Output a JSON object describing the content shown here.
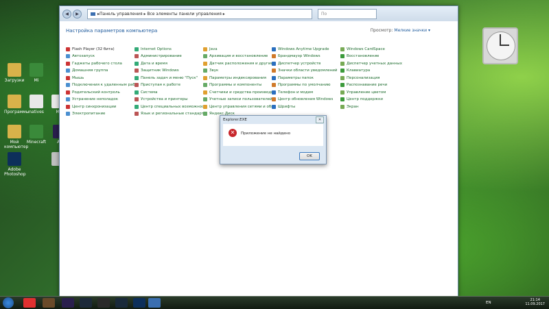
{
  "desktop": {
    "icons": [
      {
        "label": "Загрузки",
        "color": "#d8b24a"
      },
      {
        "label": "Mi",
        "color": "#3a8a3a"
      },
      {
        "label": "Программы",
        "color": "#d8b24a"
      },
      {
        "label": "natives",
        "color": "#e8e8e8"
      },
      {
        "label": "Mi",
        "color": "#e8e8e8"
      },
      {
        "label": "Мой компьютер",
        "color": "#d8b24a"
      },
      {
        "label": "Minecraft",
        "color": "#3a8a3a"
      },
      {
        "label": "Ae",
        "color": "#2a1f4d"
      },
      {
        "label": "Adobe Photoshop",
        "color": "#0d2f5a"
      },
      {
        "label": "",
        "color": "#c0c0c0"
      }
    ]
  },
  "window": {
    "address": {
      "path1": "Панель управления",
      "path2": "Все элементы панели управления",
      "search_placeholder": "По"
    },
    "title": "Настройка параметров компьютера",
    "view_label": "Просмотр:",
    "view_value": "Мелкие значки ▾",
    "items": [
      [
        "Flash Player (32 бита)",
        "Internet Options",
        "Java",
        "Windows Anytime Upgrade",
        "Windows CardSpace"
      ],
      [
        "Автозапуск",
        "Администрирование",
        "Архивация и восстановление",
        "Брандмауэр Windows",
        "Восстановление"
      ],
      [
        "Гаджеты рабочего стола",
        "Дата и время",
        "Датчик расположения и другие дат...",
        "Диспетчер устройств",
        "Диспетчер учетных данных"
      ],
      [
        "Домашняя группа",
        "Защитник Windows",
        "Звук",
        "Значки области уведомлений",
        "Клавиатура"
      ],
      [
        "Мышь",
        "Панель задач и меню \"Пуск\"",
        "Параметры индексирования",
        "Параметры папок",
        "Персонализация"
      ],
      [
        "Подключения к удаленным рабоч...",
        "Приступая к работе",
        "Программы и компоненты",
        "Программы по умолчанию",
        "Распознавание речи"
      ],
      [
        "Родительский контроль",
        "Система",
        "Счетчики и средства производител...",
        "Телефон и модем",
        "Управление цветом"
      ],
      [
        "Устранение неполадок",
        "Устройства и принтеры",
        "Учетные записи пользователей",
        "Центр обновления Windows",
        "Центр поддержки"
      ],
      [
        "Центр синхронизации",
        "Центр специальных возможностей",
        "Центр управления сетями и общи...",
        "Шрифты",
        "Экран"
      ],
      [
        "Электропитание",
        "Язык и региональные стандарты",
        "Яндекс.Диск",
        "",
        ""
      ]
    ]
  },
  "dialog": {
    "title": "Explorer.EXE",
    "message": "Приложение не найдено",
    "ok_label": "OK",
    "close_label": "✕"
  },
  "taskbar": {
    "lang": "EN",
    "time": "21:14",
    "date": "11.09.2017",
    "apps": [
      "Яндекс",
      "Minecraft",
      "Ae",
      "Windows",
      "Media Player",
      "Steam",
      "Ps",
      "Explorer"
    ]
  }
}
